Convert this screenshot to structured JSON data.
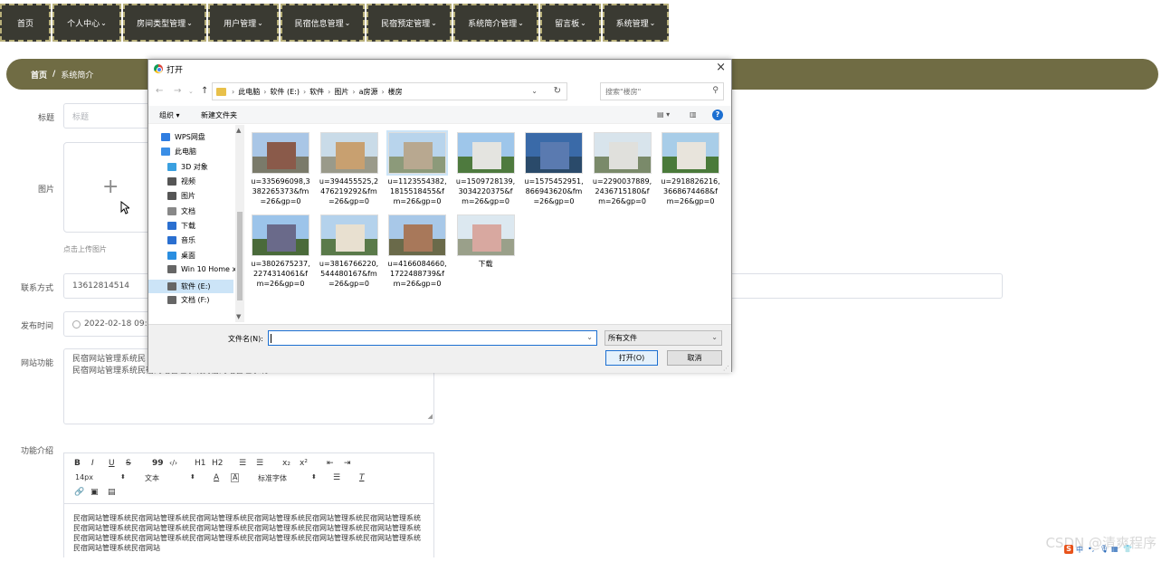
{
  "nav": {
    "items": [
      {
        "label": "首页",
        "has_dropdown": false
      },
      {
        "label": "个人中心",
        "has_dropdown": true
      },
      {
        "label": "房间类型管理",
        "has_dropdown": true
      },
      {
        "label": "用户管理",
        "has_dropdown": true
      },
      {
        "label": "民宿信息管理",
        "has_dropdown": true
      },
      {
        "label": "民宿预定管理",
        "has_dropdown": true
      },
      {
        "label": "系统简介管理",
        "has_dropdown": true
      },
      {
        "label": "留言板",
        "has_dropdown": true
      },
      {
        "label": "系统管理",
        "has_dropdown": true
      }
    ],
    "chevron": "⌄"
  },
  "breadcrumb": {
    "home": "首页",
    "separator": "/",
    "current": "系统简介"
  },
  "form": {
    "title_label": "标题",
    "title_placeholder": "标题",
    "image_label": "图片",
    "upload_hint": "点击上传图片",
    "phone_label": "联系方式",
    "phone_value": "13612814514",
    "date_label": "发布时间",
    "date_value": "2022-02-18 09:0",
    "features_label": "网站功能",
    "features_line1": "民宿网站管理系统民",
    "features_line2": "民宿网站管理系统民宿网站管理系统民宿网站管理系统",
    "intro_label": "功能介绍",
    "editor": {
      "row1": [
        "B",
        "I",
        "U",
        "S",
        "99",
        "‹/›",
        "H1",
        "H2",
        "☰",
        "☰",
        "x₂",
        "x²",
        "⇤",
        "⇥"
      ],
      "font_size": "14px",
      "text_type": "文本",
      "font_family": "标准字体",
      "body": "民宿网站管理系统民宿网站管理系统民宿网站管理系统民宿网站管理系统民宿网站管理系统民宿网站管理系统民宿网站管理系统民宿网站管理系统民宿网站管理系统民宿网站管理系统民宿网站管理系统民宿网站管理系统民宿网站管理系统民宿网站管理系统民宿网站管理系统民宿网站管理系统民宿网站管理系统民宿网站管理系统民宿网站管理系统民宿网站"
    }
  },
  "dialog": {
    "title": "打开",
    "close": "×",
    "path": [
      "此电脑",
      "软件 (E:)",
      "软件",
      "图片",
      "a房源",
      "楼房"
    ],
    "search_placeholder": "搜索\"楼房\"",
    "organize": "组织 ▾",
    "new_folder": "新建文件夹",
    "help": "?",
    "nav_pane": [
      {
        "label": "WPS网盘",
        "icon": "cloud-icon",
        "color": "#2f7de1"
      },
      {
        "label": "此电脑",
        "icon": "computer-icon",
        "color": "#3a8ee6"
      },
      {
        "label": "3D 对象",
        "icon": "cube-icon",
        "color": "#3aa0e0"
      },
      {
        "label": "视频",
        "icon": "video-icon",
        "color": "#555555"
      },
      {
        "label": "图片",
        "icon": "picture-icon",
        "color": "#555555"
      },
      {
        "label": "文档",
        "icon": "document-icon",
        "color": "#888888"
      },
      {
        "label": "下载",
        "icon": "download-icon",
        "color": "#2a6fd0"
      },
      {
        "label": "音乐",
        "icon": "music-icon",
        "color": "#2a6fd0"
      },
      {
        "label": "桌面",
        "icon": "desktop-icon",
        "color": "#2a8ee0"
      },
      {
        "label": "Win 10 Home x",
        "icon": "drive-icon",
        "color": "#666666"
      },
      {
        "label": "软件 (E:)",
        "icon": "drive-icon",
        "color": "#666666"
      },
      {
        "label": "文档 (F:)",
        "icon": "drive-icon",
        "color": "#666666"
      }
    ],
    "files": [
      {
        "name": [
          "u=335696098,3",
          "382265373&fm",
          "=26&gp=0"
        ],
        "sky": "#a9c6e6",
        "ground": "#7a7a6a",
        "bldg": "#8a5a4a"
      },
      {
        "name": [
          "u=394455525,2",
          "476219292&fm",
          "=26&gp=0"
        ],
        "sky": "#c9dbe8",
        "ground": "#9a9a8a",
        "bldg": "#c8a070"
      },
      {
        "name": [
          "u=1123554382,",
          "1815518455&f",
          "m=26&gp=0"
        ],
        "sky": "#b8d4ec",
        "ground": "#8c9a7a",
        "bldg": "#b8a890"
      },
      {
        "name": [
          "u=1509728139,",
          "3034220375&f",
          "m=26&gp=0"
        ],
        "sky": "#9ec6ea",
        "ground": "#4e7a3e",
        "bldg": "#e4e4e0"
      },
      {
        "name": [
          "u=1575452951,",
          "866943620&fm",
          "=26&gp=0"
        ],
        "sky": "#3a6aa8",
        "ground": "#2a4a6a",
        "bldg": "#5a7ab0"
      },
      {
        "name": [
          "u=2290037889,",
          "2436715180&f",
          "m=26&gp=0"
        ],
        "sky": "#d8e4ec",
        "ground": "#7a8a6a",
        "bldg": "#e0e0dc"
      },
      {
        "name": [
          "u=2918826216,",
          "3668674468&f",
          "m=26&gp=0"
        ],
        "sky": "#a8cde8",
        "ground": "#4a7a3a",
        "bldg": "#e8e4dc"
      },
      {
        "name": [
          "u=3802675237,",
          "2274314061&f",
          "m=26&gp=0"
        ],
        "sky": "#9cc4ea",
        "ground": "#4a6a3a",
        "bldg": "#6a6a8a"
      },
      {
        "name": [
          "u=3816766220,",
          "544480167&fm",
          "=26&gp=0"
        ],
        "sky": "#b4d2ec",
        "ground": "#5a7a4a",
        "bldg": "#e8e0d0"
      },
      {
        "name": [
          "u=4166084660,",
          "1722488739&f",
          "m=26&gp=0"
        ],
        "sky": "#a8c8e8",
        "ground": "#6a6a4a",
        "bldg": "#a8785a"
      },
      {
        "name": [
          "下载"
        ],
        "sky": "#dce8f0",
        "ground": "#9aa08a",
        "bldg": "#d8a8a0"
      }
    ],
    "filename_label": "文件名(N):",
    "filetype": "所有文件",
    "open_button": "打开(O)",
    "cancel_button": "取消"
  },
  "watermark": "CSDN @清爽程序",
  "colors": {
    "nav_bg": "#3a3a32",
    "nav_border": "#b8b07a",
    "breadcrumb_bg": "#706c44",
    "dialog_accent": "#1c6fd1"
  }
}
